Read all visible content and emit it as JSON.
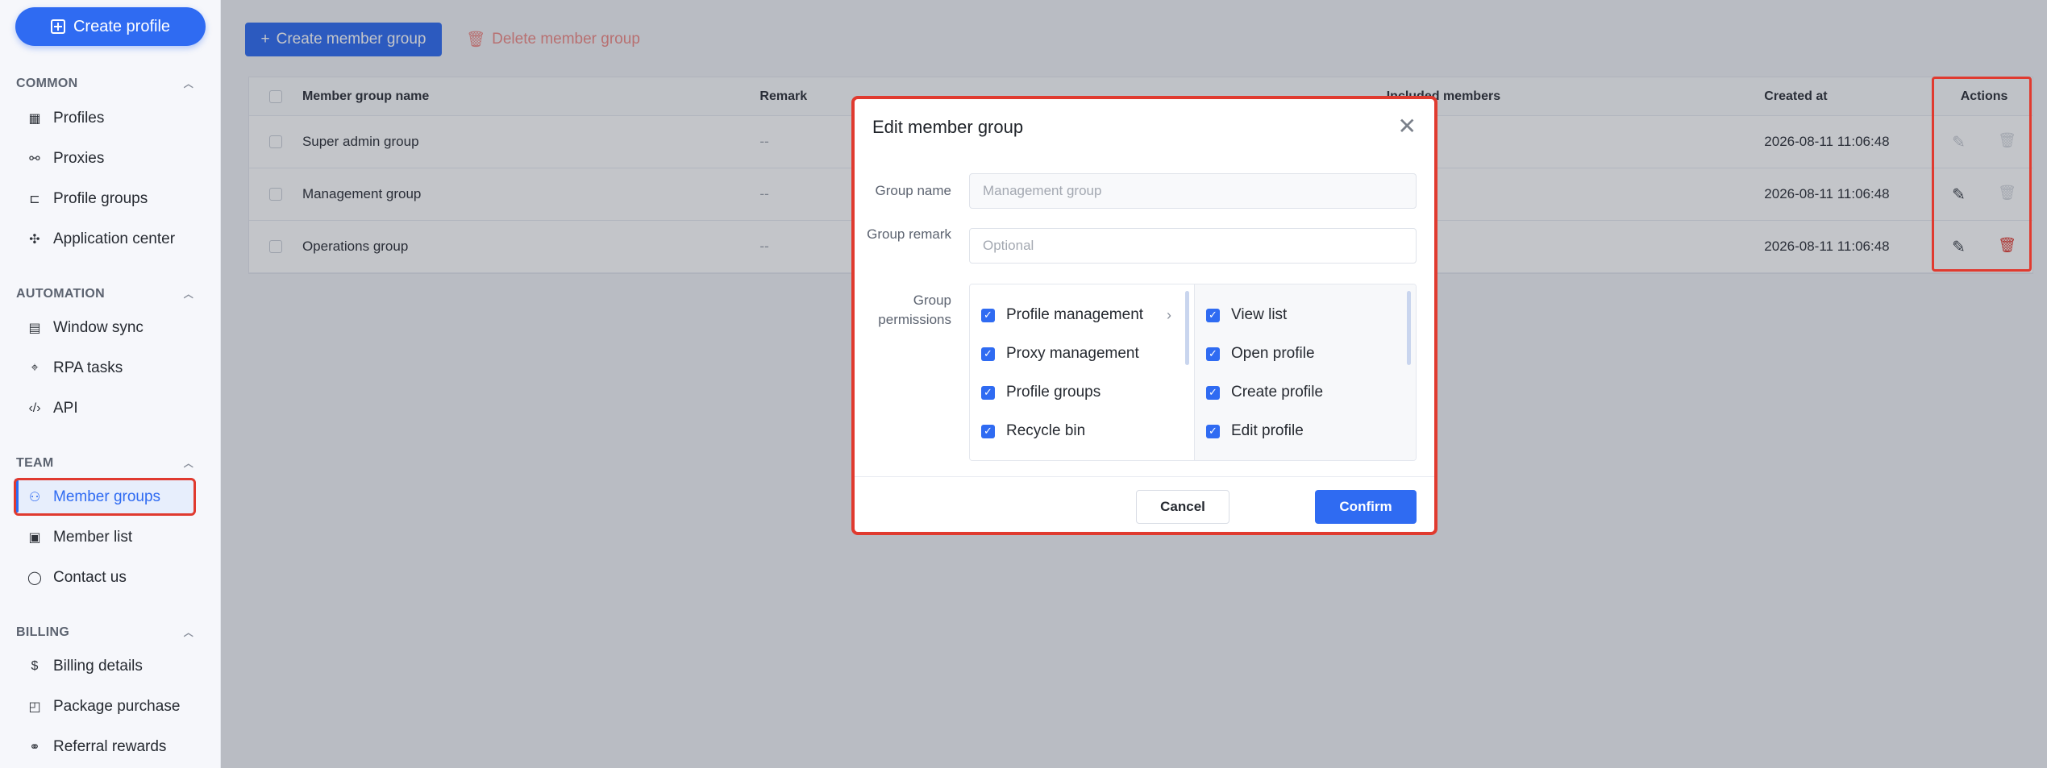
{
  "sidebar": {
    "create_label": "Create profile",
    "sections": {
      "common": "COMMON",
      "automation": "AUTOMATION",
      "team": "TEAM",
      "billing": "BILLING"
    },
    "items": {
      "profiles": "Profiles",
      "proxies": "Proxies",
      "profile_groups": "Profile groups",
      "application_center": "Application center",
      "window_sync": "Window sync",
      "rpa_tasks": "RPA tasks",
      "api": "API",
      "member_groups": "Member groups",
      "member_list": "Member list",
      "contact_us": "Contact us",
      "billing_details": "Billing details",
      "package_purchase": "Package purchase",
      "referral_rewards": "Referral rewards"
    }
  },
  "toolbar": {
    "create_group": "Create member group",
    "delete_group": "Delete member group"
  },
  "table": {
    "headers": {
      "name": "Member group name",
      "remark": "Remark",
      "included": "Included members",
      "created": "Created at",
      "actions": "Actions"
    },
    "rows": [
      {
        "name": "Super admin group",
        "remark": "--",
        "created": "2026-08-11 11:06:48"
      },
      {
        "name": "Management group",
        "remark": "--",
        "created": "2026-08-11 11:06:48"
      },
      {
        "name": "Operations group",
        "remark": "--",
        "created": "2026-08-11 11:06:48"
      }
    ]
  },
  "modal": {
    "title": "Edit member group",
    "group_name_label": "Group name",
    "group_name_value": "Management group",
    "group_remark_label": "Group remark",
    "group_remark_placeholder": "Optional",
    "permissions_label": "Group permissions",
    "left_permissions": [
      "Profile management",
      "Proxy management",
      "Profile groups",
      "Recycle bin"
    ],
    "right_permissions": [
      "View list",
      "Open profile",
      "Create profile",
      "Edit profile"
    ],
    "cancel_label": "Cancel",
    "confirm_label": "Confirm"
  },
  "colors": {
    "accent": "#2f6bf2",
    "highlight": "#e03a2f",
    "danger": "#e0382f"
  }
}
